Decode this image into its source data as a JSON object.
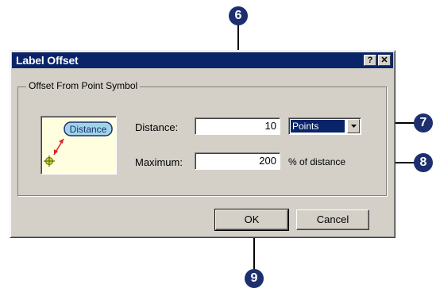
{
  "dialog": {
    "title": "Label Offset",
    "help_glyph": "?",
    "close_glyph": "✕",
    "group_title": "Offset From Point Symbol",
    "preview_label": "Distance",
    "distance_label": "Distance:",
    "distance_value": "10",
    "units_selected": "Points",
    "maximum_label": "Maximum:",
    "maximum_value": "200",
    "maximum_suffix": "% of distance",
    "ok_label": "OK",
    "cancel_label": "Cancel"
  },
  "callouts": {
    "c6": "6",
    "c7": "7",
    "c8": "8",
    "c9": "9"
  },
  "colors": {
    "titlebar": "#0a246a",
    "dialog_bg": "#d4d0c8",
    "callout": "#1d2f6e",
    "arrow": "#e0202a",
    "preview_bg": "#ffffe0"
  }
}
